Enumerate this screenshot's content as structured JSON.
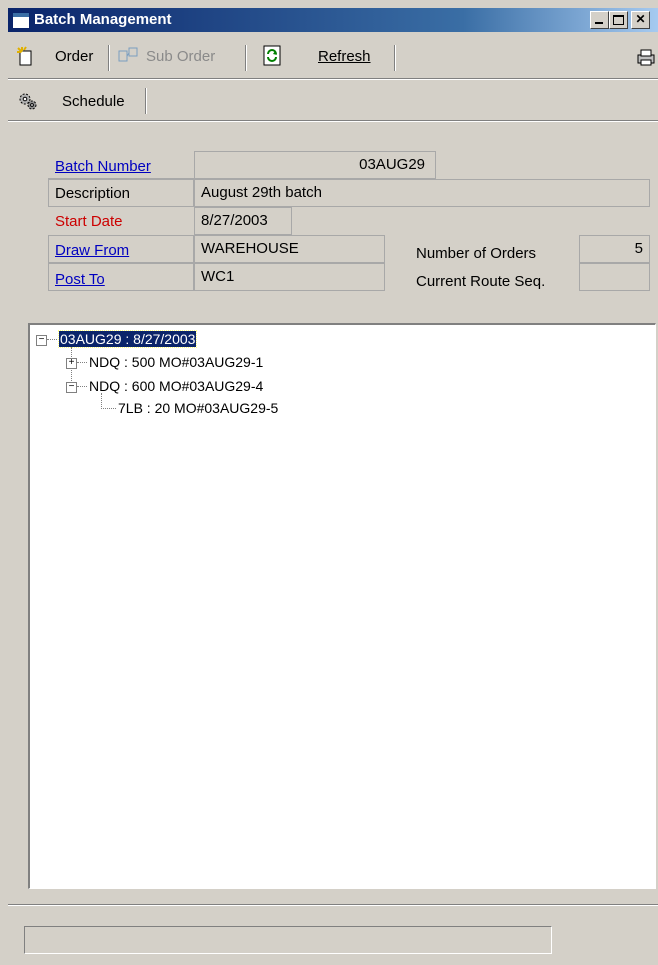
{
  "window": {
    "title": "Batch Management"
  },
  "toolbar": {
    "order_label": "Order",
    "sub_order_label": "Sub Order",
    "refresh_label": "Refresh",
    "schedule_label": "Schedule"
  },
  "form": {
    "batch_number_label": "Batch Number",
    "batch_number_value": "03AUG29",
    "description_label": "Description",
    "description_value": "August 29th batch",
    "start_date_label": "Start Date",
    "start_date_value": "8/27/2003",
    "draw_from_label": "Draw From",
    "draw_from_value": "WAREHOUSE",
    "post_to_label": "Post To",
    "post_to_value": "WC1",
    "number_of_orders_label": "Number of Orders",
    "number_of_orders_value": "5",
    "current_route_seq_label": "Current Route Seq.",
    "current_route_seq_value": ""
  },
  "tree": {
    "root": "03AUG29 : 8/27/2003",
    "children": [
      {
        "label": "NDQ : 500  MO#03AUG29-1",
        "expanded": false
      },
      {
        "label": "NDQ : 600  MO#03AUG29-4",
        "expanded": true,
        "children": [
          {
            "label": "7LB : 20  MO#03AUG29-5"
          }
        ]
      }
    ]
  },
  "statusbar": {
    "text": ""
  },
  "colors": {
    "titlebar": "#0a246a",
    "link": "#0000c0",
    "required": "#cc0000",
    "selection": "#0a246a"
  }
}
